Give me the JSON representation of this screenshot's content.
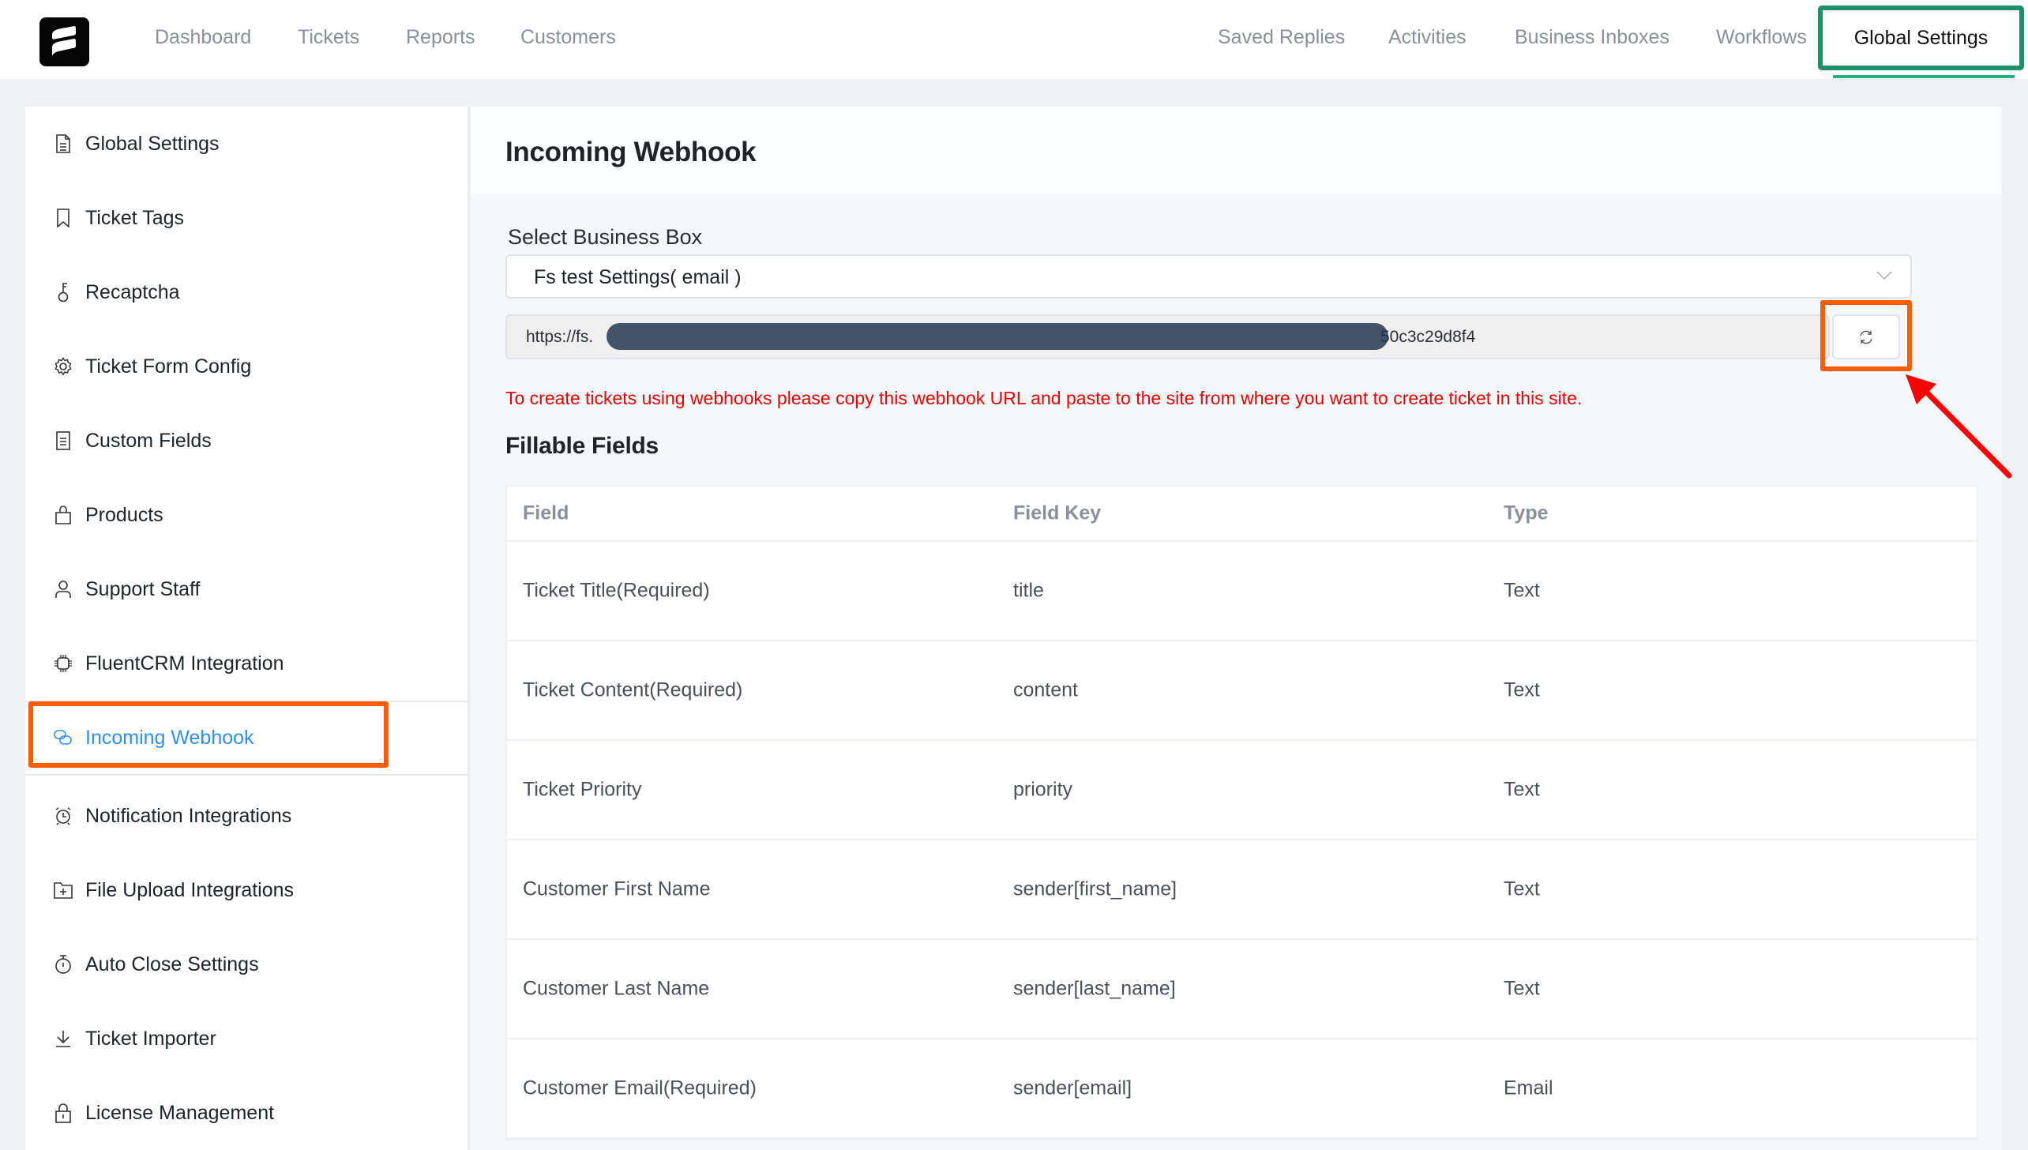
{
  "topnav": {
    "left": [
      "Dashboard",
      "Tickets",
      "Reports",
      "Customers"
    ],
    "right": [
      "Saved Replies",
      "Activities",
      "Business Inboxes",
      "Workflows"
    ],
    "active": "Global Settings"
  },
  "sidebar": {
    "items": [
      {
        "label": "Global Settings",
        "icon": "document-icon"
      },
      {
        "label": "Ticket Tags",
        "icon": "bookmark-icon"
      },
      {
        "label": "Recaptcha",
        "icon": "key-icon"
      },
      {
        "label": "Ticket Form Config",
        "icon": "gear-icon"
      },
      {
        "label": "Custom Fields",
        "icon": "list-document-icon"
      },
      {
        "label": "Products",
        "icon": "shopping-bag-icon"
      },
      {
        "label": "Support Staff",
        "icon": "user-icon"
      },
      {
        "label": "FluentCRM Integration",
        "icon": "chip-icon"
      },
      {
        "label": "Incoming Webhook",
        "icon": "link-icon",
        "active": true
      },
      {
        "label": "Notification Integrations",
        "icon": "alarm-clock-icon"
      },
      {
        "label": "File Upload Integrations",
        "icon": "folder-add-icon"
      },
      {
        "label": "Auto Close Settings",
        "icon": "stopwatch-icon"
      },
      {
        "label": "Ticket Importer",
        "icon": "download-icon"
      },
      {
        "label": "License Management",
        "icon": "lock-icon"
      }
    ]
  },
  "main": {
    "title": "Incoming Webhook",
    "select_label": "Select Business Box",
    "select_value": "Fs test Settings( email )",
    "webhook_url_prefix": "https://fs.",
    "webhook_url_suffix": "50c3c29d8f4",
    "notice": "To create tickets using webhooks please copy this webhook URL and paste to the site from where you want to create ticket in this site.",
    "fillable_title": "Fillable Fields",
    "table": {
      "headers": [
        "Field",
        "Field Key",
        "Type"
      ],
      "rows": [
        [
          "Ticket Title(Required)",
          "title",
          "Text"
        ],
        [
          "Ticket Content(Required)",
          "content",
          "Text"
        ],
        [
          "Ticket Priority",
          "priority",
          "Text"
        ],
        [
          "Customer First Name",
          "sender[first_name]",
          "Text"
        ],
        [
          "Customer Last Name",
          "sender[last_name]",
          "Text"
        ],
        [
          "Customer Email(Required)",
          "sender[email]",
          "Email"
        ]
      ]
    }
  },
  "colors": {
    "active_tab_border": "#1f8f65",
    "active_tab_underline": "#22b07d",
    "annotation_box": "#ff5c00",
    "annotation_arrow": "#ff0000",
    "sidebar_active": "#2f8ff0",
    "notice_text": "#ec0000"
  }
}
